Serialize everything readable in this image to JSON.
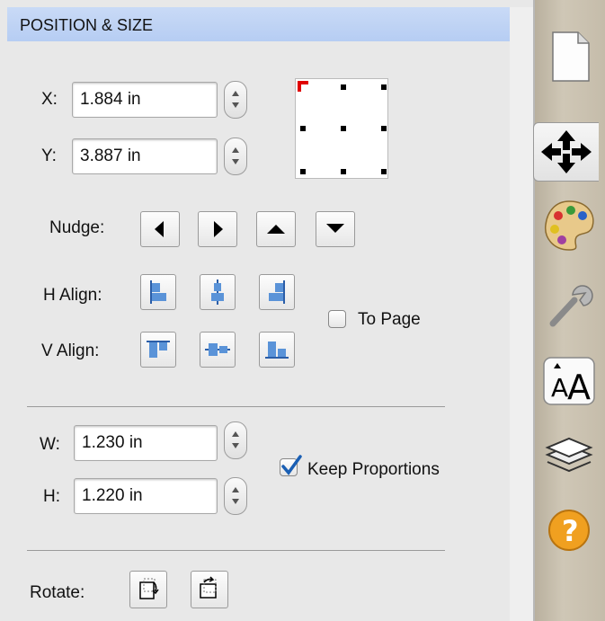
{
  "panel": {
    "title": "POSITION & SIZE"
  },
  "position": {
    "x_label": "X:",
    "x_value": "1.884 in",
    "y_label": "Y:",
    "y_value": "3.887 in"
  },
  "nudge": {
    "label": "Nudge:",
    "buttons": [
      "arrow-left-icon",
      "arrow-right-icon",
      "arrow-up-icon",
      "arrow-down-icon"
    ]
  },
  "align": {
    "h_label": "H Align:",
    "v_label": "V Align:",
    "to_page_label": "To Page",
    "to_page_checked": false
  },
  "size": {
    "w_label": "W:",
    "w_value": "1.230 in",
    "h_label": "H:",
    "h_value": "1.220 in",
    "keep_proportions_label": "Keep Proportions",
    "keep_proportions_checked": true
  },
  "rotate": {
    "label": "Rotate:"
  },
  "toolbar": {
    "items": [
      "document-icon",
      "move-icon",
      "palette-icon",
      "wrench-icon",
      "text-size-icon",
      "layers-icon",
      "help-icon"
    ],
    "selected": "move-icon",
    "help_glyph": "?",
    "text_glyph": "A"
  },
  "colors": {
    "header": "#c0d4f5",
    "anchor_selected": "#e00000",
    "align_icon": "#5a93d8",
    "check": "#1a5fb4",
    "help": "#f0a020"
  }
}
